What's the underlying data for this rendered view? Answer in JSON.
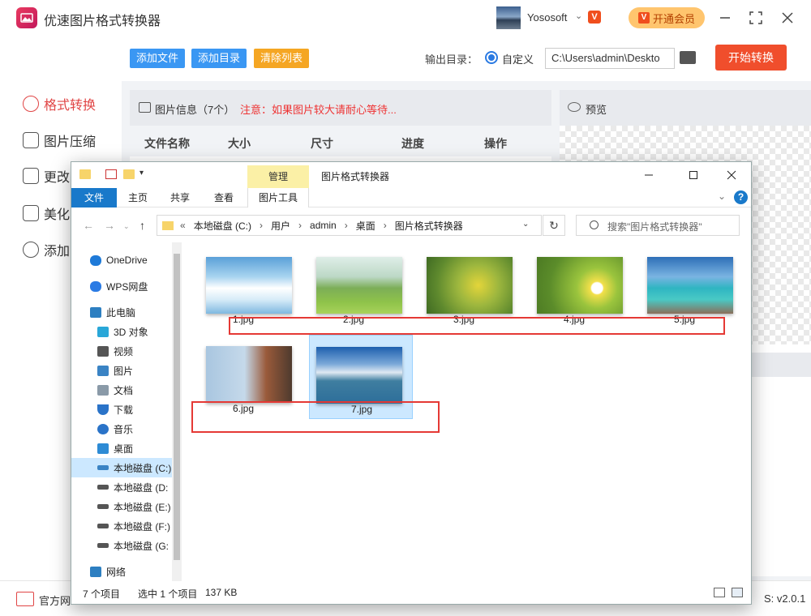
{
  "app": {
    "title": "优速图片格式转换器",
    "user_name": "Yososoft",
    "vip_label": "开通会员",
    "vip_mark": "V"
  },
  "sidebar": {
    "items": [
      {
        "label": "格式转换"
      },
      {
        "label": "图片压缩"
      },
      {
        "label": "更改"
      },
      {
        "label": "美化"
      },
      {
        "label": "添加"
      }
    ]
  },
  "toolbar": {
    "add_file": "添加文件",
    "add_dir": "添加目录",
    "clear_list": "清除列表",
    "output_label": "输出目录：",
    "custom_label": "自定义",
    "output_path": "C:\\Users\\admin\\Deskto",
    "start": "开始转换"
  },
  "info": {
    "title": "图片信息（7个）",
    "note": "注意：如果图片较大请耐心等待...",
    "columns": [
      "文件名称",
      "大小",
      "尺寸",
      "进度",
      "操作"
    ]
  },
  "preview": {
    "title": "预览"
  },
  "footer": {
    "link": "官方网",
    "version": "S: v2.0.1"
  },
  "explorer": {
    "manage_tab": "管理",
    "window_title": "图片格式转换器",
    "ribbon_tabs": [
      "文件",
      "主页",
      "共享",
      "查看",
      "图片工具"
    ],
    "help": "?",
    "breadcrumb": [
      "«",
      "本地磁盘 (C:)",
      "›",
      "用户",
      "›",
      "admin",
      "›",
      "桌面",
      "›",
      "图片格式转换器"
    ],
    "search_placeholder": "搜索\"图片格式转换器\"",
    "tree": [
      {
        "label": "OneDrive",
        "color": "#1e7ad8"
      },
      {
        "label": "WPS网盘",
        "color": "#2b7be4"
      },
      {
        "label": "此电脑",
        "color": "#2d7fc1"
      },
      {
        "label": "3D 对象",
        "color": "#29a7d8"
      },
      {
        "label": "视频",
        "color": "#555"
      },
      {
        "label": "图片",
        "color": "#3a83c4"
      },
      {
        "label": "文档",
        "color": "#8a9aa8"
      },
      {
        "label": "下载",
        "color": "#2a73c8"
      },
      {
        "label": "音乐",
        "color": "#2a73c8"
      },
      {
        "label": "桌面",
        "color": "#2d8bd5"
      },
      {
        "label": "本地磁盘 (C:)",
        "color": "#3a83c4"
      },
      {
        "label": "本地磁盘 (D:",
        "color": "#555"
      },
      {
        "label": "本地磁盘 (E:)",
        "color": "#555"
      },
      {
        "label": "本地磁盘 (F:)",
        "color": "#555"
      },
      {
        "label": "本地磁盘 (G:",
        "color": "#555"
      },
      {
        "label": "网络",
        "color": "#2d7fc1"
      }
    ],
    "files": [
      {
        "name": "1.jpg",
        "scene": "sky-clouds"
      },
      {
        "name": "2.jpg",
        "scene": "green-field"
      },
      {
        "name": "3.jpg",
        "scene": "yellow-flowers"
      },
      {
        "name": "4.jpg",
        "scene": "daisies"
      },
      {
        "name": "5.jpg",
        "scene": "pier-sea"
      },
      {
        "name": "6.jpg",
        "scene": "lake-house"
      },
      {
        "name": "7.jpg",
        "scene": "lake-town"
      }
    ],
    "status": {
      "count": "7 个项目",
      "selected": "选中 1 个项目",
      "size": "137 KB"
    }
  },
  "colors": {
    "accent_red": "#e04545",
    "primary_blue": "#3a97f3",
    "start_red": "#f04e2c",
    "annotation_red": "#e53935"
  }
}
